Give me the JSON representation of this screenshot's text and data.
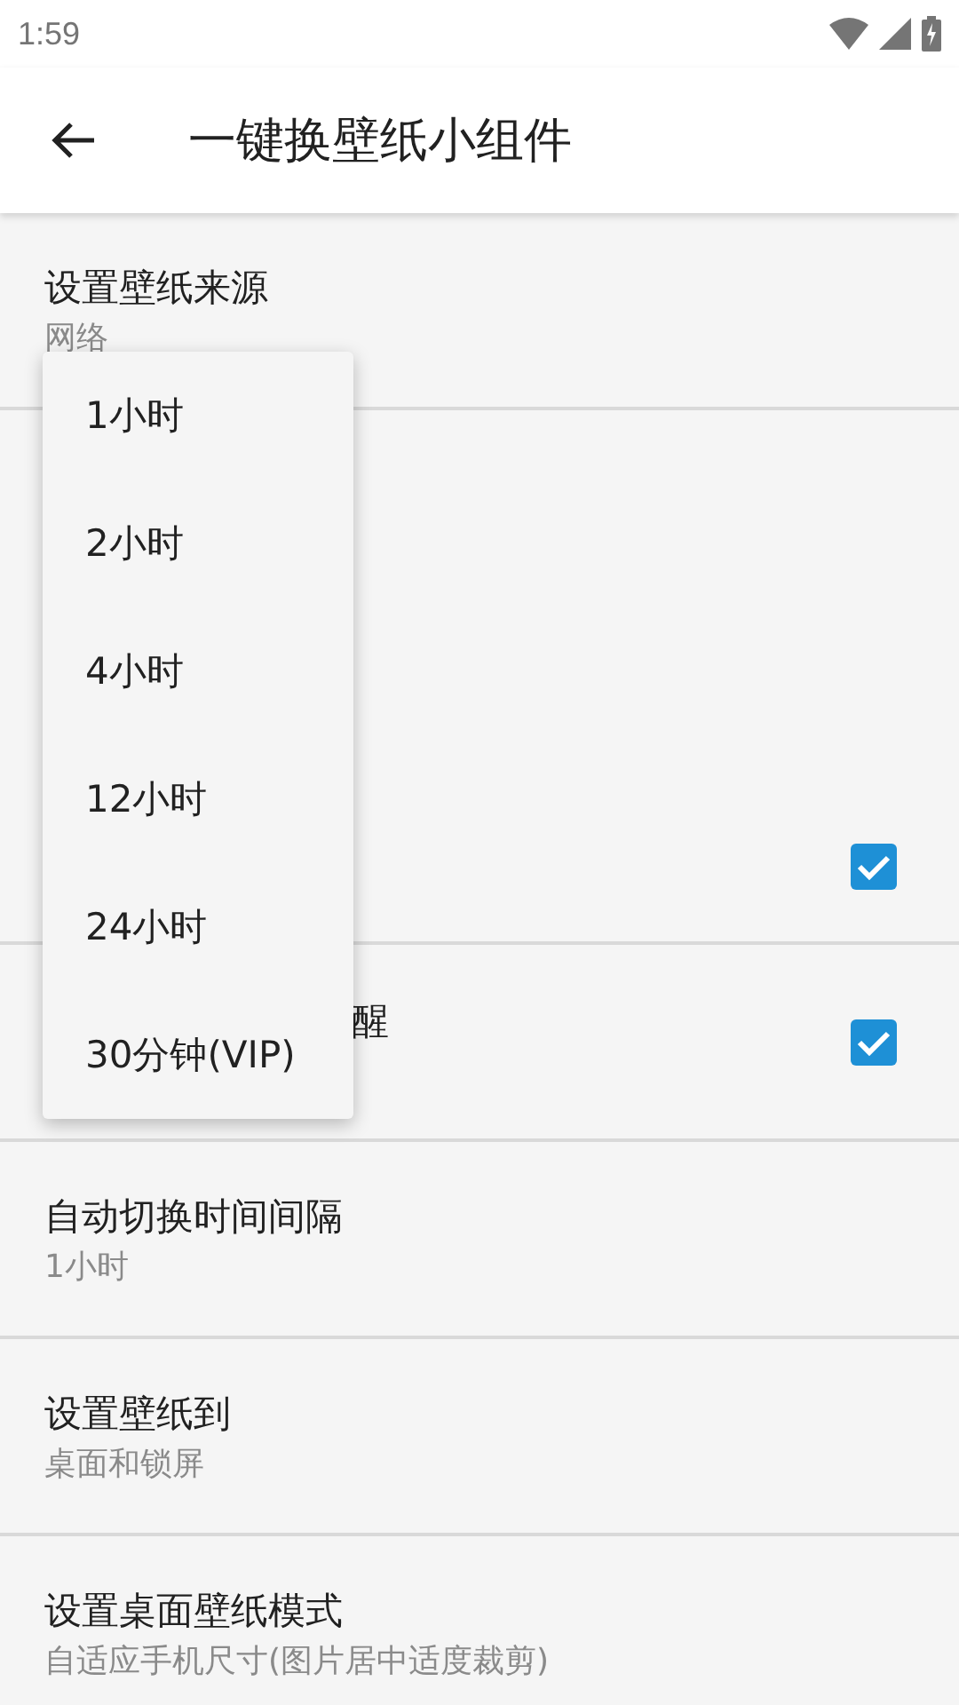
{
  "status_bar": {
    "time": "1:59"
  },
  "app_bar": {
    "title": "一键换壁纸小组件"
  },
  "settings": [
    {
      "kind": "text",
      "title": "设置壁纸来源",
      "summary": "网络",
      "covered": false
    },
    {
      "kind": "checkbox",
      "checked": true,
      "tall": true,
      "covered": false
    },
    {
      "kind": "checkbox",
      "title": "醒",
      "checked": true,
      "covered": true
    },
    {
      "kind": "text",
      "title": "自动切换时间间隔",
      "summary": "1小时",
      "covered": false
    },
    {
      "kind": "text",
      "title": "设置壁纸到",
      "summary": "桌面和锁屏",
      "covered": false
    },
    {
      "kind": "text",
      "title": "设置桌面壁纸模式",
      "summary": "自适应手机尺寸(图片居中适度裁剪)",
      "covered": false
    }
  ],
  "menu": {
    "items": [
      "1小时",
      "2小时",
      "4小时",
      "12小时",
      "24小时",
      "30分钟(VIP)"
    ]
  }
}
